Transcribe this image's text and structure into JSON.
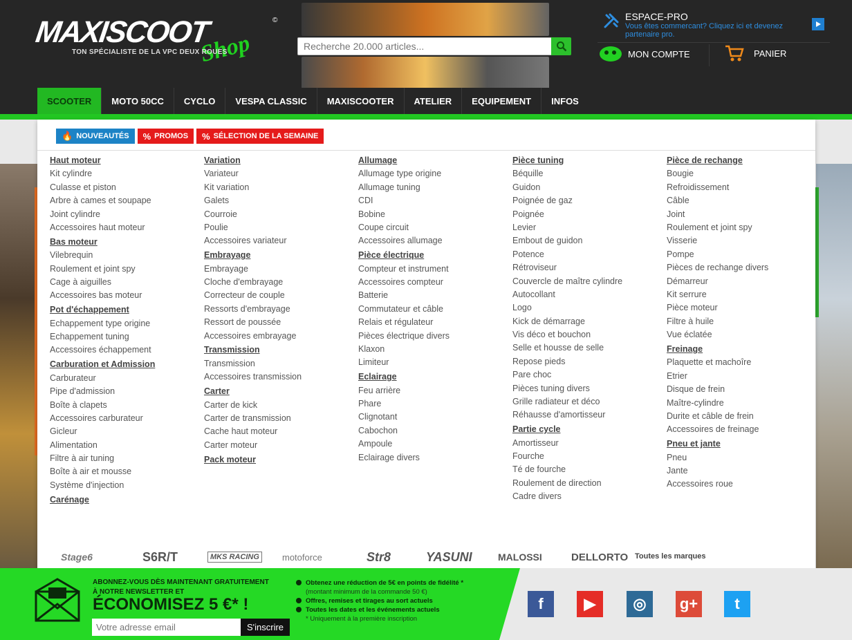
{
  "header": {
    "logo_text": "MAXISCOOT",
    "logo_shop": "Shop",
    "logo_tagline": "TON SPÉCIALISTE DE LA VPC DEUX ROUES",
    "search_placeholder": "Recherche 20.000 articles...",
    "espace_title": "ESPACE-PRO",
    "espace_sub": "Vous êtes commercant? Cliquez ici et devenez partenaire pro.",
    "account_label": "MON COMPTE",
    "cart_label": "PANIER"
  },
  "nav": [
    "SCOOTER",
    "MOTO 50CC",
    "CYCLO",
    "VESPA CLASSIC",
    "MAXISCOOTER",
    "ATELIER",
    "EQUIPEMENT",
    "INFOS"
  ],
  "tabs": [
    {
      "label": "NOUVEAUTÉS",
      "color": "#1c83c6",
      "icon": "fire-icon"
    },
    {
      "label": "PROMOS",
      "color": "#e51b1b",
      "icon": "percent-icon"
    },
    {
      "label": "SÉLECTION DE LA SEMAINE",
      "color": "#e51b1b",
      "icon": "percent-icon"
    }
  ],
  "columns": [
    [
      {
        "title": "Haut moteur",
        "items": [
          "Kit cylindre",
          "Culasse et piston",
          "Arbre à cames et soupape",
          "Joint cylindre",
          "Accessoires haut moteur"
        ]
      },
      {
        "title": "Bas moteur",
        "items": [
          "Vilebrequin",
          "Roulement et joint spy",
          "Cage à aiguilles",
          "Accessoires bas moteur"
        ]
      },
      {
        "title": "Pot d'échappement",
        "items": [
          "Echappement type origine",
          "Echappement tuning",
          "Accessoires échappement"
        ]
      },
      {
        "title": "Carburation et Admission",
        "items": [
          "Carburateur",
          "Pipe d'admission",
          "Boîte à clapets",
          "Accessoires carburateur",
          "Gicleur",
          "Alimentation",
          "Filtre à air tuning",
          "Boîte à air et mousse",
          "Système d'injection"
        ]
      },
      {
        "title": "Carénage",
        "items": []
      }
    ],
    [
      {
        "title": "Variation",
        "items": [
          "Variateur",
          "Kit variation",
          "Galets",
          "Courroie",
          "Poulie",
          "Accessoires variateur"
        ]
      },
      {
        "title": "Embrayage",
        "items": [
          "Embrayage",
          "Cloche d'embrayage",
          "Correcteur de couple",
          "Ressorts d'embrayage",
          "Ressort de poussée",
          "Accessoires embrayage"
        ]
      },
      {
        "title": "Transmission",
        "items": [
          "Transmission",
          "Accessoires transmission"
        ]
      },
      {
        "title": "Carter",
        "items": [
          "Carter de kick",
          "Carter de transmission",
          "Cache haut moteur",
          "Carter moteur"
        ]
      },
      {
        "title": "Pack moteur",
        "items": []
      }
    ],
    [
      {
        "title": "Allumage",
        "items": [
          "Allumage type origine",
          "Allumage tuning",
          "CDI",
          "Bobine",
          "Coupe circuit",
          "Accessoires allumage"
        ]
      },
      {
        "title": "Pièce électrique",
        "items": [
          "Compteur et instrument",
          "Accessoires compteur",
          "Batterie",
          "Commutateur et câble",
          "Relais et régulateur",
          "Pièces électrique divers",
          "Klaxon",
          "Limiteur"
        ]
      },
      {
        "title": "Eclairage",
        "items": [
          "Feu arrière",
          "Phare",
          "Clignotant",
          "Cabochon",
          "Ampoule",
          "Eclairage divers"
        ]
      }
    ],
    [
      {
        "title": "Pièce tuning",
        "items": [
          "Béquille",
          "Guidon",
          "Poignée de gaz",
          "Poignée",
          "Levier",
          "Embout de guidon",
          "Potence",
          "Rétroviseur",
          "Couvercle de maître cylindre",
          "Autocollant",
          "Logo",
          "Kick de démarrage",
          "Vis déco et bouchon",
          "Selle et housse de selle",
          "Repose pieds",
          "Pare choc",
          "Pièces tuning divers",
          "Grille radiateur et déco",
          "Réhausse d'amortisseur"
        ]
      },
      {
        "title": "Partie cycle",
        "items": [
          "Amortisseur",
          "Fourche",
          "Té de fourche",
          "Roulement de direction",
          "Cadre divers"
        ]
      }
    ],
    [
      {
        "title": "Pièce de rechange",
        "items": [
          "Bougie",
          "Refroidissement",
          "Câble",
          "Joint",
          "Roulement et joint spy",
          "Visserie",
          "Pompe",
          "Pièces de rechange divers",
          "Démarreur",
          "Kit serrure",
          "Pièce moteur",
          "Filtre à huile",
          "Vue éclatée"
        ]
      },
      {
        "title": "Freinage",
        "items": [
          "Plaquette et machoîre",
          "Etrier",
          "Disque de frein",
          "Maître-cylindre",
          "Durite et câble de frein",
          "Accessoires de freinage"
        ]
      },
      {
        "title": "Pneu et jante",
        "items": [
          "Pneu",
          "Jante",
          "Accessoires roue"
        ]
      }
    ]
  ],
  "brands": [
    "Stage6",
    "S6R/T",
    "MKS RACING",
    "motoforce",
    "Str8",
    "YASUNI",
    "MALOSSI",
    "DELLORTO"
  ],
  "all_brands_label": "Toutes les marques",
  "newsletter": {
    "line1": "ABONNEZ-VOUS DÈS MAINTENANT GRATUITEMENT",
    "line2": "À NOTRE NEWSLETTER ET",
    "big": "ÉCONOMISEZ 5 €* !",
    "input_placeholder": "Votre adresse email",
    "button": "S'inscrire",
    "b1": "Obtenez une réduction de 5€ en points de fidélité *",
    "b1_small": "(montant minimum de la commande 50 €)",
    "b2": "Offres, remises et tirages au sort actuels",
    "b3": "Toutes les dates et les événements actuels",
    "note": "* Uniquement à la première inscription"
  },
  "social": [
    {
      "name": "facebook",
      "glyph": "f",
      "color": "#3b5998"
    },
    {
      "name": "youtube",
      "glyph": "▶",
      "color": "#e52d27"
    },
    {
      "name": "instagram",
      "glyph": "◎",
      "color": "#2e6a96"
    },
    {
      "name": "google-plus",
      "glyph": "g+",
      "color": "#dd4b39"
    },
    {
      "name": "twitter",
      "glyph": "t",
      "color": "#1da1f2"
    }
  ]
}
